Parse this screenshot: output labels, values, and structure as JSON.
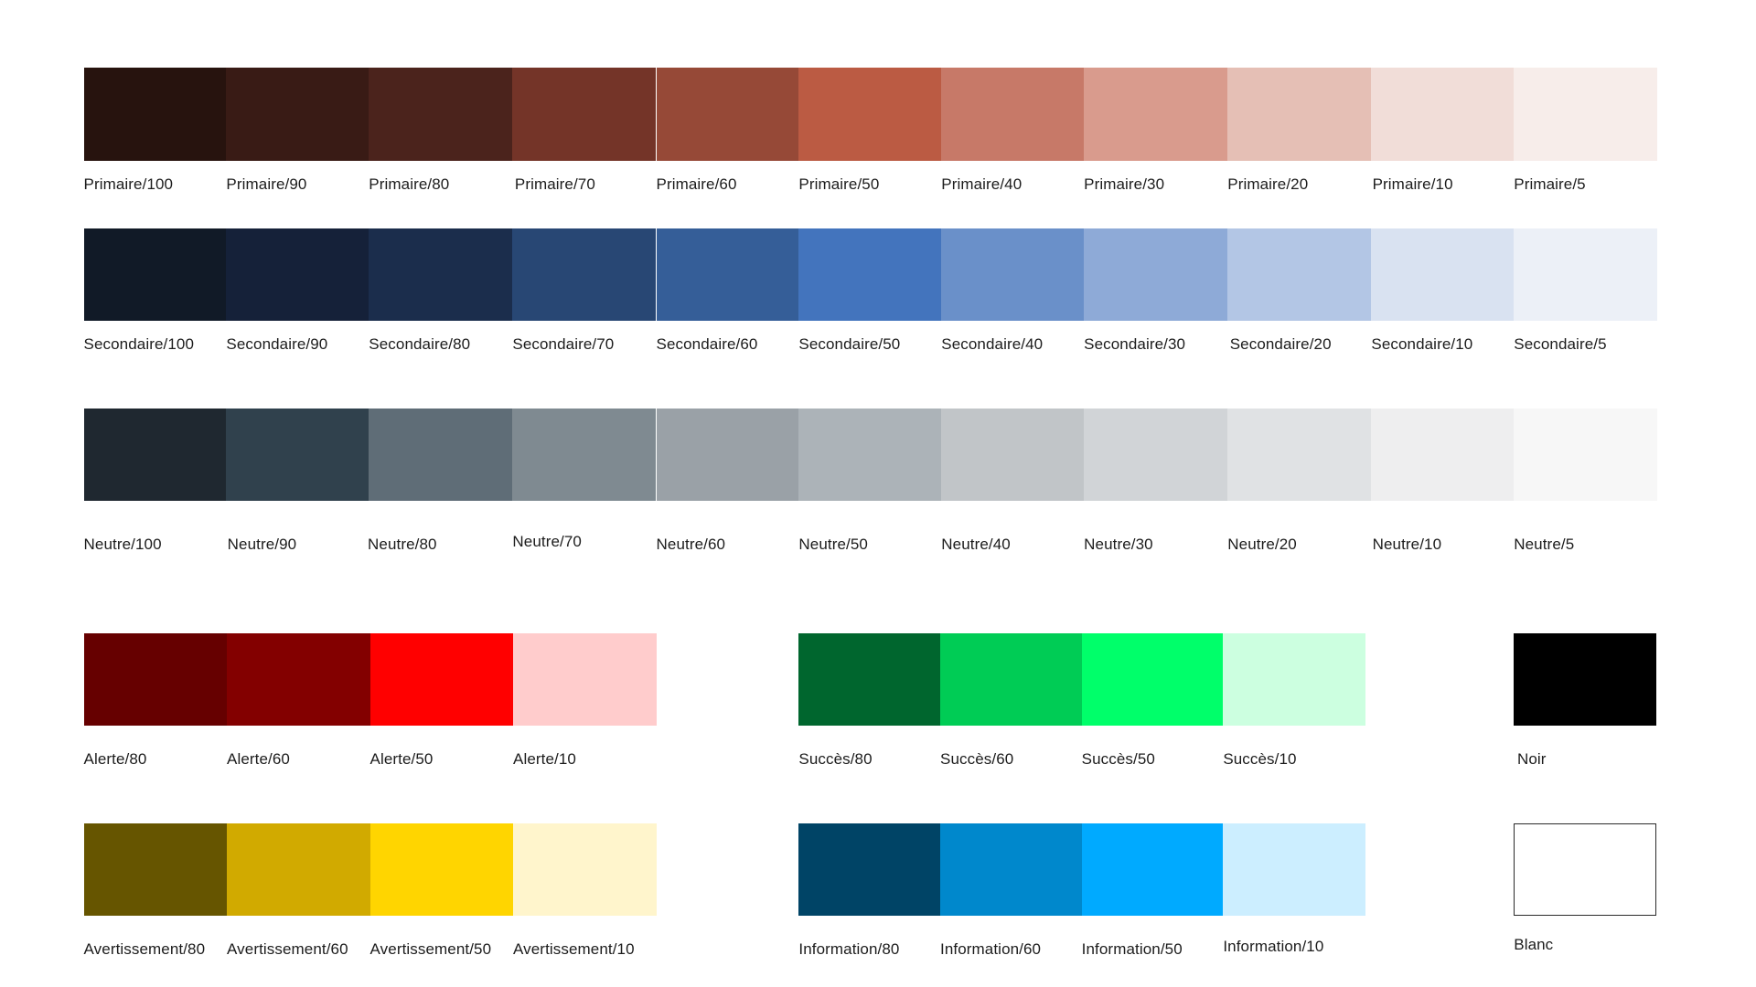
{
  "palette": {
    "primaire": [
      {
        "name": "Primaire/100",
        "color": "#27130e"
      },
      {
        "name": "Primaire/90",
        "color": "#391b15"
      },
      {
        "name": "Primaire/80",
        "color": "#4b231c"
      },
      {
        "name": "Primaire/70",
        "color": "#743428"
      },
      {
        "name": "Primaire/60",
        "color": "#964937"
      },
      {
        "name": "Primaire/50",
        "color": "#bb5b43"
      },
      {
        "name": "Primaire/40",
        "color": "#c77968"
      },
      {
        "name": "Primaire/30",
        "color": "#d99b8d"
      },
      {
        "name": "Primaire/20",
        "color": "#e5bfb5"
      },
      {
        "name": "Primaire/10",
        "color": "#f1ddd8"
      },
      {
        "name": "Primaire/5",
        "color": "#f7edea"
      }
    ],
    "secondaire": [
      {
        "name": "Secondaire/100",
        "color": "#111a27"
      },
      {
        "name": "Secondaire/90",
        "color": "#152139"
      },
      {
        "name": "Secondaire/80",
        "color": "#1b2d4c"
      },
      {
        "name": "Secondaire/70",
        "color": "#284774"
      },
      {
        "name": "Secondaire/60",
        "color": "#355e98"
      },
      {
        "name": "Secondaire/50",
        "color": "#4374bd"
      },
      {
        "name": "Secondaire/40",
        "color": "#6a90c9"
      },
      {
        "name": "Secondaire/30",
        "color": "#8eaad7"
      },
      {
        "name": "Secondaire/20",
        "color": "#b3c6e5"
      },
      {
        "name": "Secondaire/10",
        "color": "#d9e2f1"
      },
      {
        "name": "Secondaire/5",
        "color": "#ecf0f7"
      }
    ],
    "neutre": [
      {
        "name": "Neutre/100",
        "color": "#1f2830"
      },
      {
        "name": "Neutre/90",
        "color": "#30414d"
      },
      {
        "name": "Neutre/80",
        "color": "#5f6d77"
      },
      {
        "name": "Neutre/70",
        "color": "#7f8a91"
      },
      {
        "name": "Neutre/60",
        "color": "#9aa1a7"
      },
      {
        "name": "Neutre/50",
        "color": "#acb3b8"
      },
      {
        "name": "Neutre/40",
        "color": "#c1c5c8"
      },
      {
        "name": "Neutre/30",
        "color": "#d1d4d7"
      },
      {
        "name": "Neutre/20",
        "color": "#e0e2e4"
      },
      {
        "name": "Neutre/10",
        "color": "#eeeeef"
      },
      {
        "name": "Neutre/5",
        "color": "#f7f7f7"
      }
    ],
    "alerte": [
      {
        "name": "Alerte/80",
        "color": "#660000"
      },
      {
        "name": "Alerte/60",
        "color": "#830000"
      },
      {
        "name": "Alerte/50",
        "color": "#ff0000"
      },
      {
        "name": "Alerte/10",
        "color": "#ffcccc"
      }
    ],
    "succes": [
      {
        "name": "Succès/80",
        "color": "#00662e"
      },
      {
        "name": "Succès/60",
        "color": "#00cc55"
      },
      {
        "name": "Succès/50",
        "color": "#00ff6a"
      },
      {
        "name": "Succès/10",
        "color": "#ccffe0"
      }
    ],
    "avertissement": [
      {
        "name": "Avertissement/80",
        "color": "#665500"
      },
      {
        "name": "Avertissement/60",
        "color": "#d1aa00"
      },
      {
        "name": "Avertissement/50",
        "color": "#ffd500"
      },
      {
        "name": "Avertissement/10",
        "color": "#fff5cc"
      }
    ],
    "information": [
      {
        "name": "Information/80",
        "color": "#004466"
      },
      {
        "name": "Information/60",
        "color": "#0088cc"
      },
      {
        "name": "Information/50",
        "color": "#00aaff"
      },
      {
        "name": "Information/10",
        "color": "#cceeff"
      }
    ],
    "noir": {
      "name": "Noir",
      "color": "#000000"
    },
    "blanc": {
      "name": "Blanc",
      "color": "#ffffff"
    }
  }
}
